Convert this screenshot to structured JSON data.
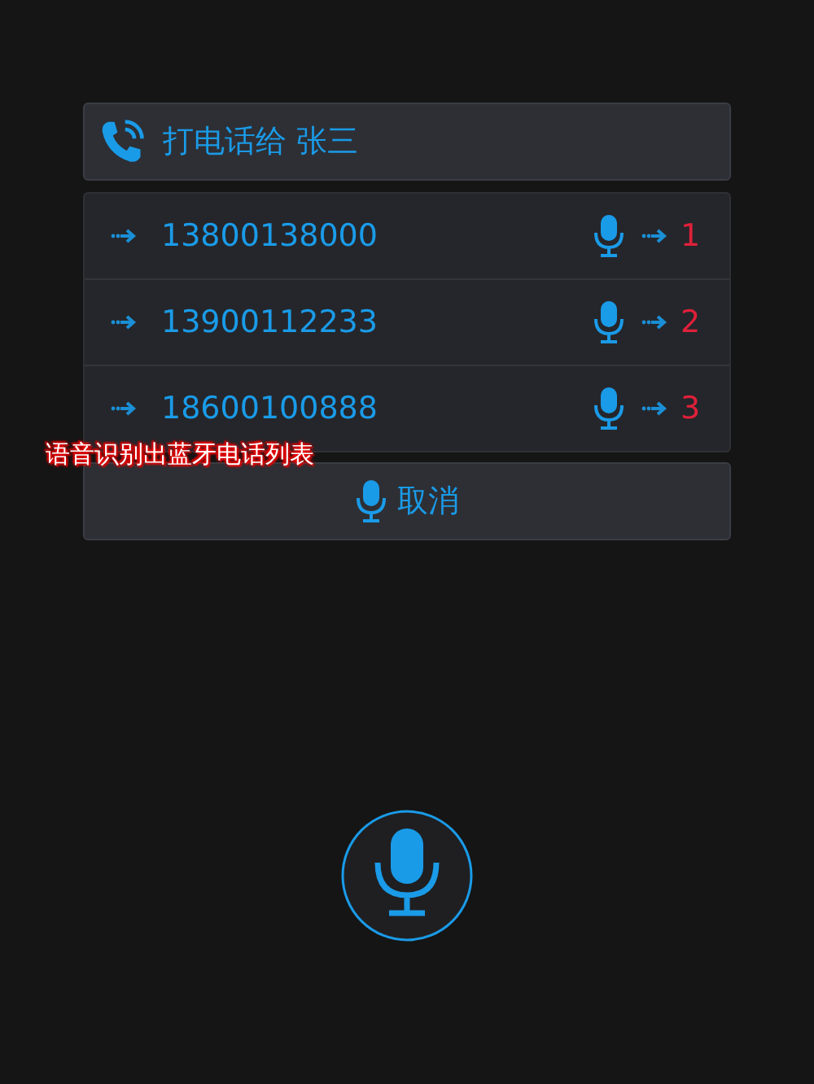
{
  "header": {
    "title": "打电话给 张三"
  },
  "numbers": [
    {
      "number": "13800138000",
      "index": "1"
    },
    {
      "number": "13900112233",
      "index": "2"
    },
    {
      "number": "18600100888",
      "index": "3"
    }
  ],
  "caption": "语音识别出蓝牙电话列表",
  "cancel_button": {
    "label": "取消"
  }
}
